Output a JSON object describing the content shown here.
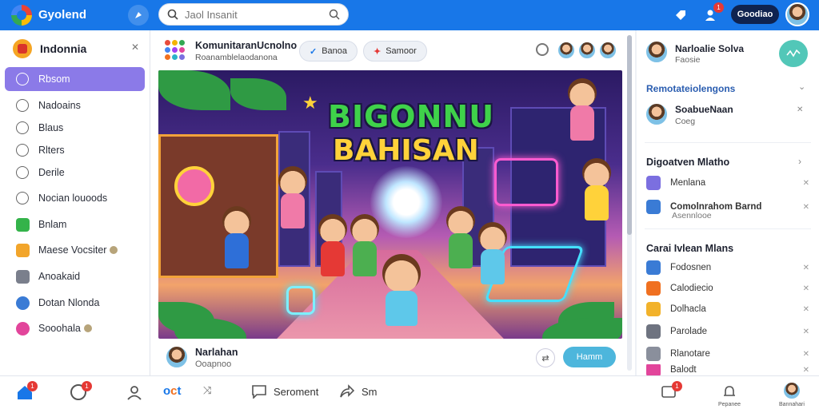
{
  "app": {
    "brand": "Gyolend",
    "accent": "#1877e8"
  },
  "header": {
    "search_placeholder": "Jaol Insanit",
    "profile_button": "Goodiao",
    "notification_count": "1"
  },
  "sidebar": {
    "title": "Indonnia",
    "items": [
      {
        "label": "Rbsom",
        "icon": "search-icon",
        "active": true
      },
      {
        "label": "Nadoains",
        "icon": "circle-icon"
      },
      {
        "label": "Blaus",
        "icon": "chat-icon"
      },
      {
        "label": "Rlters",
        "icon": "circle-icon"
      },
      {
        "label": "Derile",
        "icon": "circle-icon"
      },
      {
        "label": "Nocian louoods",
        "icon": "chat-icon"
      },
      {
        "label": "Bnlam",
        "icon": "square-green-icon",
        "color": "#34b34a"
      },
      {
        "label": "Maese Vocsiter",
        "icon": "square-orange-icon",
        "color": "#f2a52b"
      },
      {
        "label": "Anoakaid",
        "icon": "square-gray-icon",
        "color": "#7a7f8c"
      },
      {
        "label": "Dotan Nlonda",
        "icon": "circle-blue-icon",
        "color": "#3a7bd5"
      },
      {
        "label": "Sooohala",
        "icon": "circle-pink-icon",
        "color": "#e2459b"
      }
    ]
  },
  "post": {
    "header_title": "KomunitaranUcnolno",
    "header_subtitle": "Roanamblelaodanona",
    "pill1": "Banoa",
    "pill2": "Samoor",
    "art_title_line1": "BIGONNU",
    "art_title_line2": "BAHISAN",
    "footer_name": "Narlahan",
    "footer_sub": "Ooapnoo",
    "footer_button": "Hamm"
  },
  "right": {
    "profile_name": "Narloalie Solva",
    "profile_sub": "Faosie",
    "section1_title": "Remotateiolengons",
    "section1_item_name": "SoabueNaan",
    "section1_item_sub": "Coeg",
    "section2_title": "Digoatven Mlatho",
    "section2_items": [
      {
        "label": "Menlana",
        "color": "#7b6fe0"
      },
      {
        "label": "Comolnrahom Barnd",
        "sub": "Asennlooe",
        "color": "#3a7bd5"
      }
    ],
    "section3_title": "Carai Ivlean Mlans",
    "section3_items": [
      {
        "label": "Fodosnen",
        "color": "#3a7bd5"
      },
      {
        "label": "Calodiecio",
        "color": "#f07020"
      },
      {
        "label": "Dolhacla",
        "color": "#f2b22b"
      },
      {
        "label": "Parolade",
        "color": "#6e7380"
      },
      {
        "label": "Rlanotare",
        "color": "#8a8f9c"
      },
      {
        "label": "Balodt",
        "color": "#e2459b"
      }
    ]
  },
  "bottom_nav": {
    "item_comment": "Seroment",
    "item_share": "Sm",
    "caption1": "Pepanee",
    "caption2": "Bannahari",
    "badge1": "1",
    "badge2": "1",
    "badge3": "1"
  }
}
